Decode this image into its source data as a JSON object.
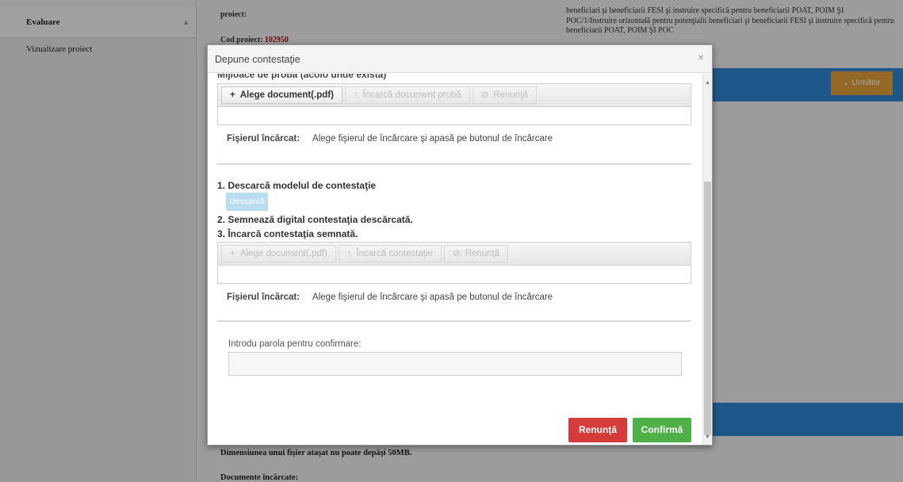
{
  "sidebar": {
    "items": [
      {
        "label": "Evaluare"
      },
      {
        "label": "Vizualizare proiect"
      }
    ]
  },
  "background": {
    "project_label": "proiect:",
    "code_label": "Cod proiect:",
    "code_value": "102950",
    "description": "beneficiari şi beneficiarii FESI şi instruire specifică pentru beneficiarii POAT, POIM ŞI POC/1/Instruire orizontală pentru potenţialii beneficiari şi beneficiarii FESI şi instruire specifică pentru beneficiarii POAT, POIM ŞI POC",
    "next_label": "Următor",
    "size_note": "Dimensiunea unui fişier ataşat nu poate depăşi 50MB.",
    "uploaded_docs": "Documente încărcate:"
  },
  "modal": {
    "title": "Depune contestaţie",
    "close": "×",
    "evidence_label": "Mijloace de probă (acolo unde există)",
    "uploader1": {
      "choose": "Alege document(.pdf)",
      "upload": "Încarcă document probă",
      "cancel": "Renunţă"
    },
    "uploader2": {
      "choose": "Alege document(.pdf)",
      "upload": "Încarcă contestaţie",
      "cancel": "Renunţă"
    },
    "file_label": "Fişierul încărcat:",
    "file_hint": "Alege fişierul de încărcare şi apasă pe butonul de încărcare",
    "step1": "1. Descarcă modelul de contestaţie",
    "download_button": "Descarcă",
    "step2": "2. Semnează digital contestaţia descărcată.",
    "step3": "3. Încarcă contestaţia semnată.",
    "password_label": "Introdu parola pentru confirmare:",
    "password_value": "",
    "cancel_button": "Renunţă",
    "confirm_button": "Confirmă"
  },
  "icons": {
    "plus": "+",
    "upload": "↑",
    "ban": "⊘",
    "chevron": "⌄"
  },
  "colors": {
    "cancel": "#d63b3b",
    "confirm": "#4fb047",
    "download": "#b9dcf2",
    "next": "#e8a33e",
    "accent_blue": "#2f88d6"
  }
}
